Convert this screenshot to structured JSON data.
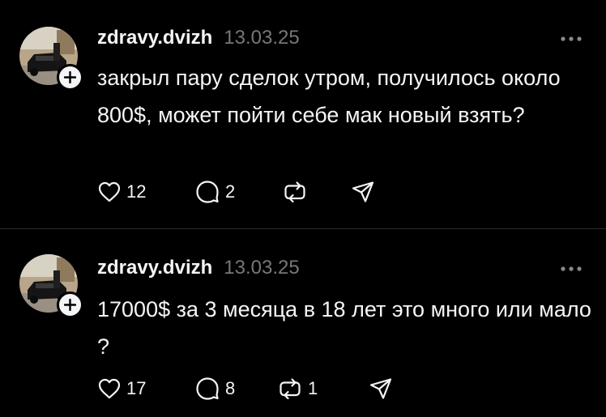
{
  "posts": [
    {
      "username": "zdravy.dvizh",
      "timestamp": "13.03.25",
      "text": "закрыл пару сделок утром, получилось около 800$, может пойти себе мак новый взять?",
      "likes": "12",
      "replies": "2",
      "reposts": "",
      "icons": [
        "heart-icon",
        "comment-icon",
        "repost-icon",
        "share-icon",
        "more-icon",
        "plus-icon"
      ]
    },
    {
      "username": "zdravy.dvizh",
      "timestamp": "13.03.25",
      "text": "17000$ за 3 месяца в 18 лет это много или мало ?",
      "likes": "17",
      "replies": "8",
      "reposts": "1",
      "icons": [
        "heart-icon",
        "comment-icon",
        "repost-icon",
        "share-icon",
        "more-icon",
        "plus-icon"
      ]
    }
  ],
  "colors": {
    "background": "#000000",
    "text": "#f3f5f7",
    "muted": "#777777",
    "divider": "#2a2a2a"
  }
}
